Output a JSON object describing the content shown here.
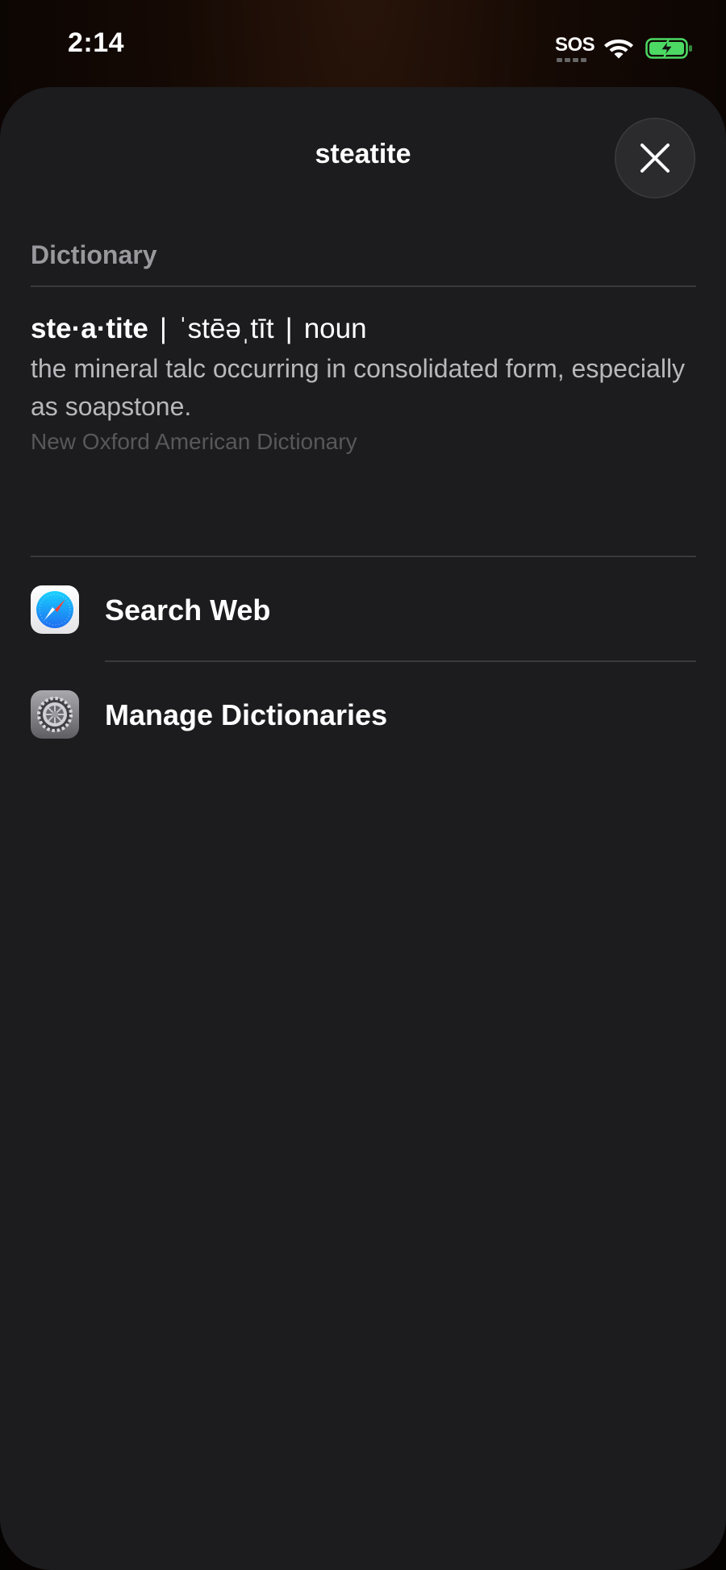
{
  "status_bar": {
    "time": "2:14",
    "sos": "SOS",
    "icons": [
      "wifi-icon",
      "battery-charging-icon"
    ],
    "battery_color": "#4cd964"
  },
  "sheet": {
    "title": "steatite",
    "close_icon": "close-icon"
  },
  "dictionary": {
    "section_label": "Dictionary",
    "headword": "ste·a·tite",
    "pronunciation": "ˈstēəˌtīt",
    "part_of_speech": "noun",
    "separator": "|",
    "definition": "the mineral talc occurring in consolidated form, especially as soapstone.",
    "source": "New Oxford American Dictionary"
  },
  "actions": [
    {
      "label": "Search Web",
      "icon": "safari-icon"
    },
    {
      "label": "Manage Dictionaries",
      "icon": "settings-gear-icon"
    }
  ],
  "colors": {
    "sheet_background": "#1c1c1e",
    "secondary_text": "#98989d",
    "tertiary_text": "#58585c",
    "safari_blue": "#1e84f0"
  }
}
